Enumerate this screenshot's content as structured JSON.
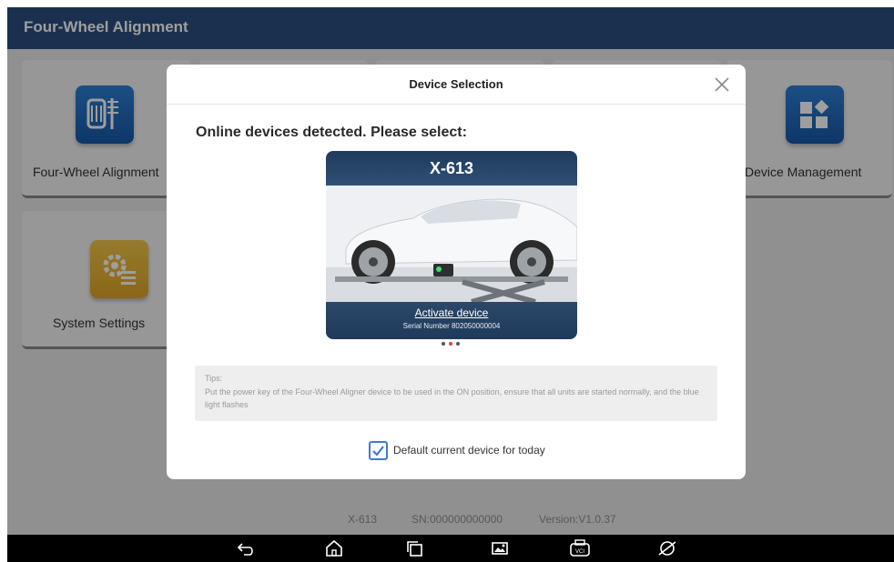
{
  "header": {
    "title": "Four-Wheel Alignment"
  },
  "tiles": [
    {
      "label": "Four-Wheel Alignment",
      "icon": "wheel-alignment-icon"
    },
    {
      "label": "Device Management",
      "icon": "apps-grid-icon"
    },
    {
      "label": "System Settings",
      "icon": "settings-gear-icon"
    }
  ],
  "footer": {
    "device": "X-613",
    "sn": "SN:000000000000",
    "version": "Version:V1.0.37"
  },
  "dialog": {
    "title": "Device Selection",
    "subtitle": "Online devices detected. Please select:",
    "device_card": {
      "name": "X-613",
      "activate_label": "Activate device",
      "serial": "Serial Number 802050000004"
    },
    "carousel": {
      "count": 3,
      "active_index": 1
    },
    "tips": {
      "label": "Tips:",
      "text": "Put the power key of the Four-Wheel Aligner device to be used in the ON position, ensure that all units are started normally, and the blue light flashes"
    },
    "default_checkbox": {
      "label": "Default current device for today",
      "checked": true
    }
  },
  "navbar": {
    "icons": [
      "back-icon",
      "home-icon",
      "recent-apps-icon",
      "screenshot-icon",
      "vci-icon",
      "browser-icon"
    ]
  },
  "colors": {
    "header": "#2a4e7f",
    "accent": "#3b7bd9",
    "card_band": "#1f3a5c"
  }
}
